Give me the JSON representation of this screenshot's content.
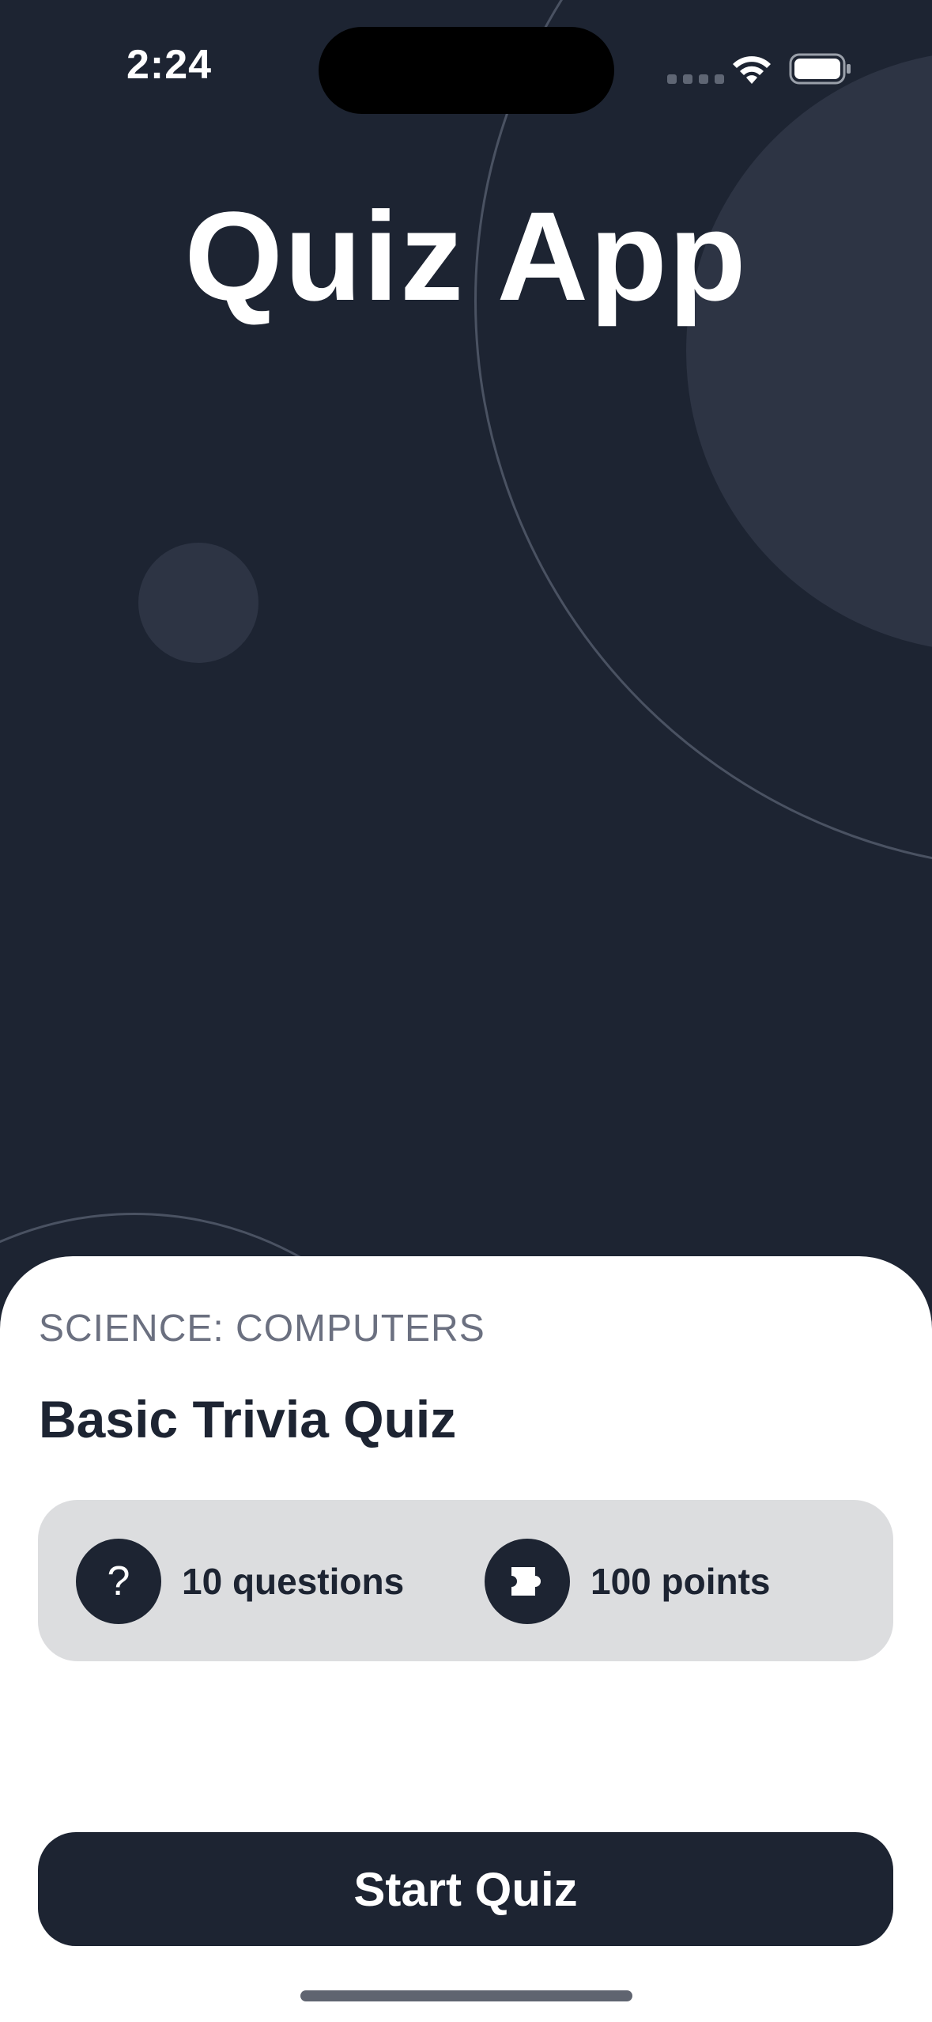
{
  "status_bar": {
    "time": "2:24"
  },
  "app": {
    "title": "Quiz App"
  },
  "quiz": {
    "category": "SCIENCE: COMPUTERS",
    "title": "Basic Trivia Quiz",
    "questions_label": "10 questions",
    "points_label": "100 points",
    "question_icon_glyph": "?"
  },
  "actions": {
    "start_label": "Start Quiz"
  },
  "icons": {
    "questions": "question-mark-icon",
    "points": "puzzle-piece-icon",
    "wifi": "wifi-icon",
    "battery": "battery-icon"
  },
  "colors": {
    "background": "#1d2432",
    "decor": "#2d3444",
    "sheet": "#ffffff",
    "info_box": "#dcdddf",
    "accent": "#1d2432"
  }
}
